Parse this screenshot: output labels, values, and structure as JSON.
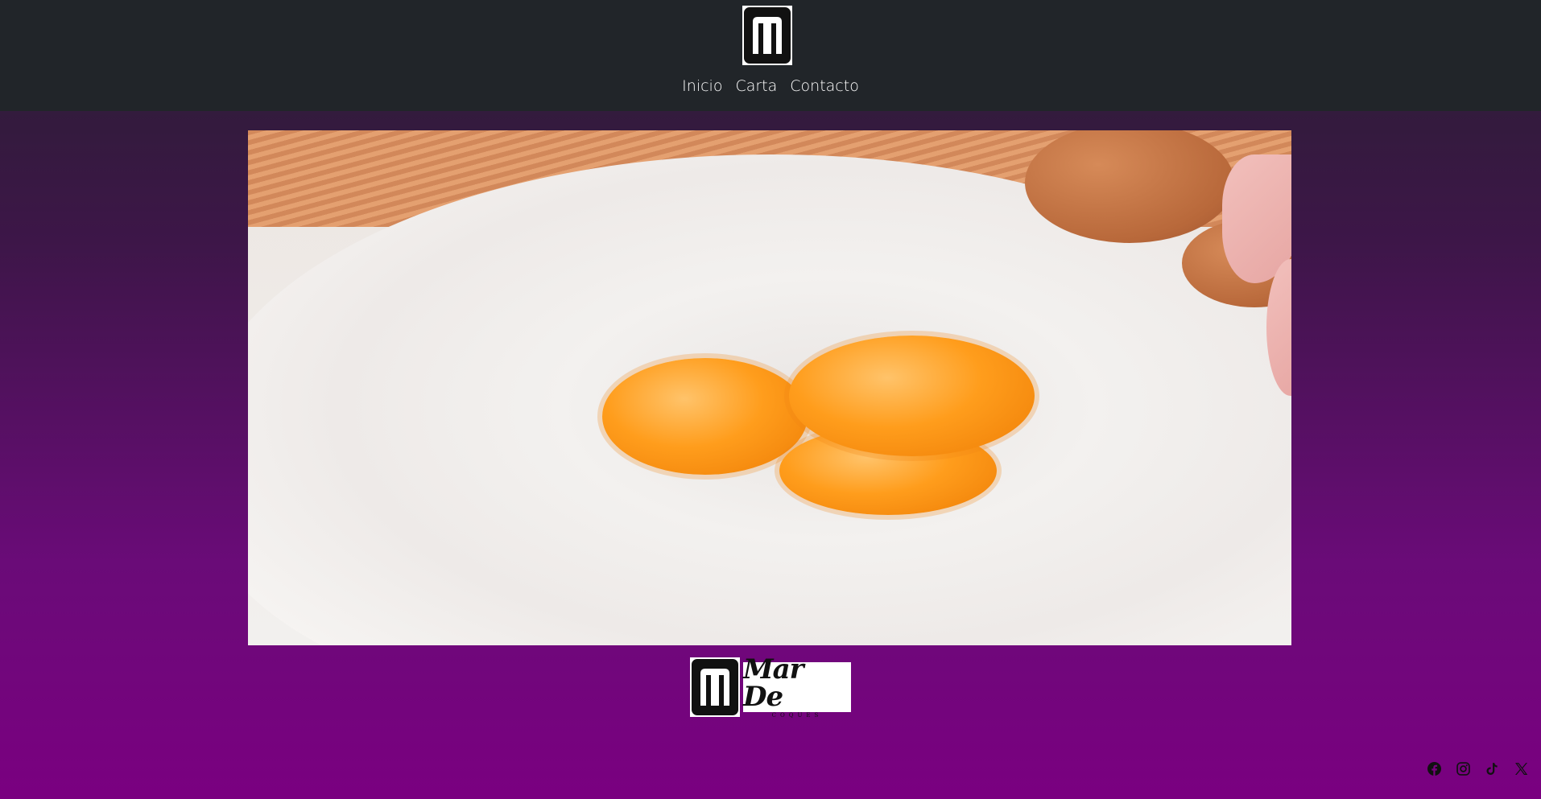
{
  "header": {
    "logo_icon": "m-logo-icon",
    "nav": [
      {
        "label": "Inicio"
      },
      {
        "label": "Carta"
      },
      {
        "label": "Contacto"
      }
    ]
  },
  "hero": {
    "image_icon": "flour-eggs-image"
  },
  "footer": {
    "logo_icon": "m-logo-icon",
    "brand_name": "Mar De",
    "brand_sub": "COQUES"
  },
  "social": [
    {
      "icon": "facebook-icon"
    },
    {
      "icon": "instagram-icon"
    },
    {
      "icon": "tiktok-icon"
    },
    {
      "icon": "x-icon"
    }
  ],
  "colors": {
    "header_bg": "#212529",
    "gradient_bottom": "#7a0080"
  }
}
